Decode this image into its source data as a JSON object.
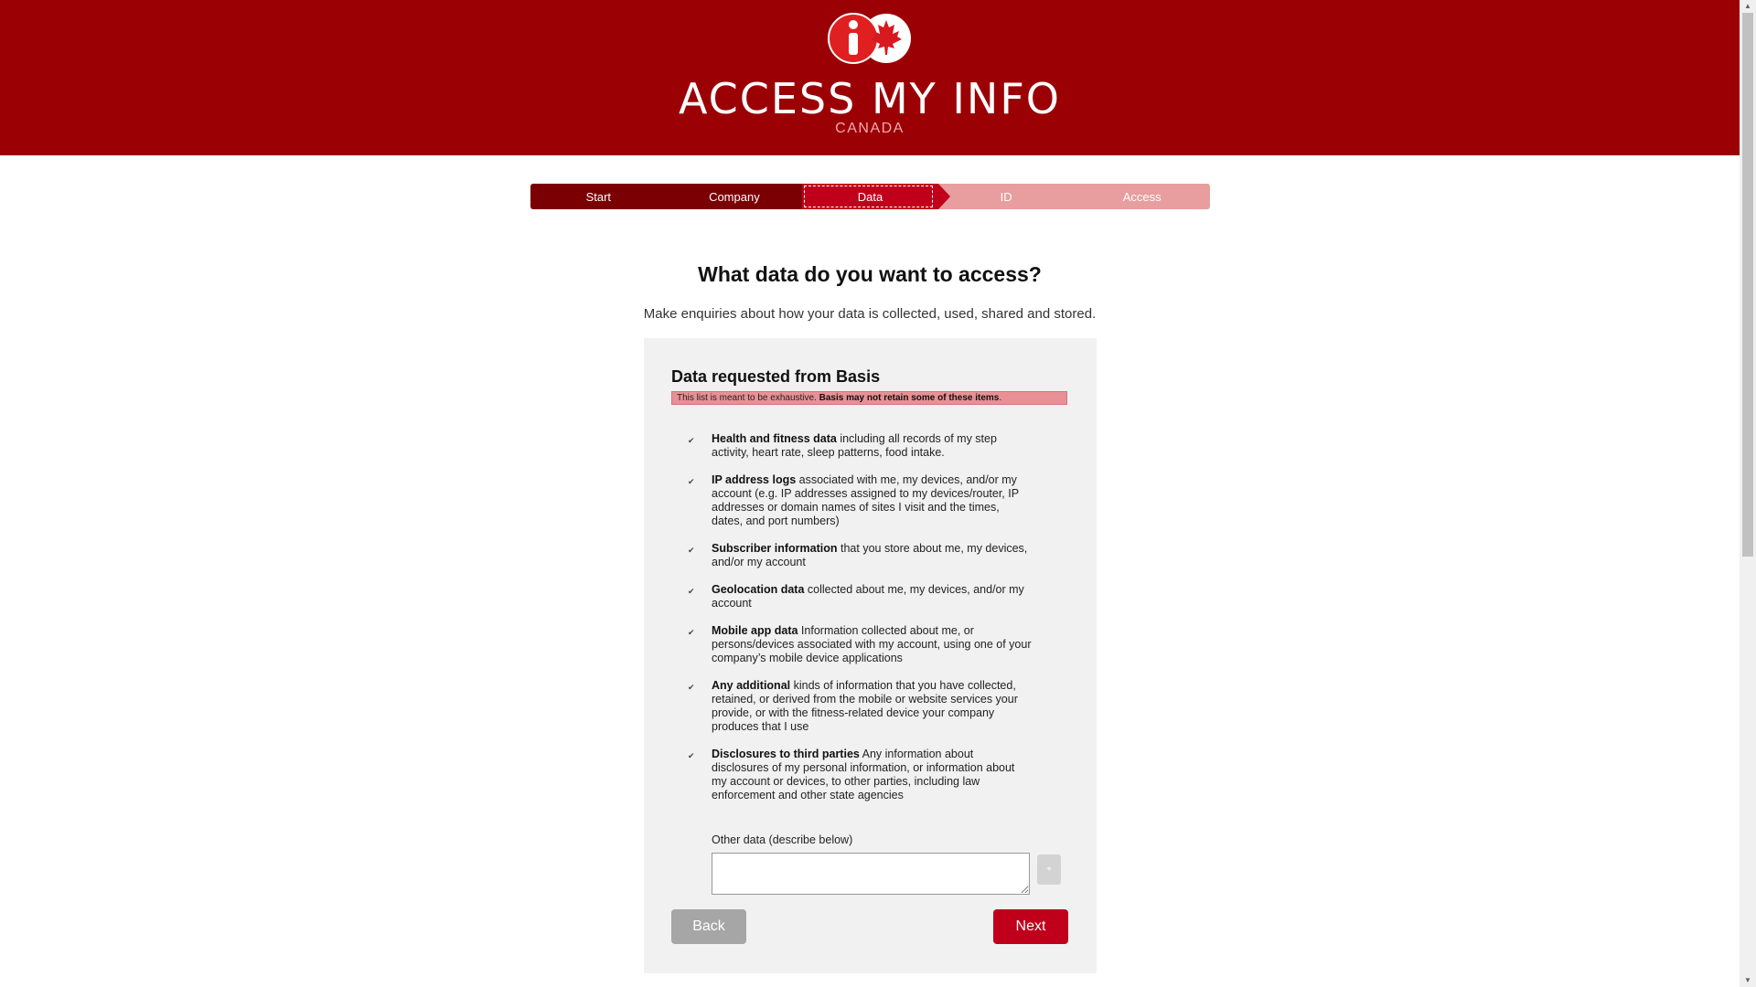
{
  "brand": {
    "title": "ACCESS MY INFO",
    "subtitle": "CANADA",
    "colors": {
      "primary": "#9b0005",
      "accent": "#c0001b",
      "light": "#e89d9f"
    }
  },
  "steps": [
    {
      "label": "Start",
      "state": "done"
    },
    {
      "label": "Company",
      "state": "done"
    },
    {
      "label": "Data",
      "state": "current"
    },
    {
      "label": "ID",
      "state": "todo"
    },
    {
      "label": "Access",
      "state": "todo"
    }
  ],
  "page": {
    "heading": "What data do you want to access?",
    "subheading": "Make enquiries about how your data is collected, used, shared and stored."
  },
  "panel": {
    "title": "Data requested from Basis",
    "notice_plain": "This list is meant to be exhaustive. ",
    "notice_bold": "Basis may not retain some of these items",
    "notice_end": ".",
    "items": [
      {
        "bold": "Health and fitness data",
        "rest": " including all records of my step activity, heart rate, sleep patterns, food intake.",
        "checked": true
      },
      {
        "bold": "IP address logs",
        "rest": " associated with me, my devices, and/or my account (e.g. IP addresses assigned to my devices/router, IP addresses or domain names of sites I visit and the times, dates, and port numbers)",
        "checked": true
      },
      {
        "bold": "Subscriber information",
        "rest": " that you store about me, my devices, and/or my account",
        "checked": true
      },
      {
        "bold": "Geolocation data",
        "rest": " collected about me, my devices, and/or my account",
        "checked": true
      },
      {
        "bold": "Mobile app data",
        "rest": " Information collected about me, or persons/devices associated with my account, using one of your company’s mobile device applications",
        "checked": true
      },
      {
        "bold": "Any additional",
        "rest": " kinds of information that you have collected, retained, or derived from the mobile or website services your provide, or with the fitness-related device your company produces that I use",
        "checked": true
      },
      {
        "bold": "Disclosures to third parties",
        "rest": " Any information about disclosures of my personal information, or information about my account or devices, to other parties, including law enforcement and other state agencies",
        "checked": true
      }
    ],
    "other_label": "Other data (describe below)",
    "other_value": "",
    "add_label": "+",
    "back_label": "Back",
    "next_label": "Next"
  },
  "icons": {
    "check": "check-icon",
    "logo": "info-maple-leaf-logo"
  }
}
